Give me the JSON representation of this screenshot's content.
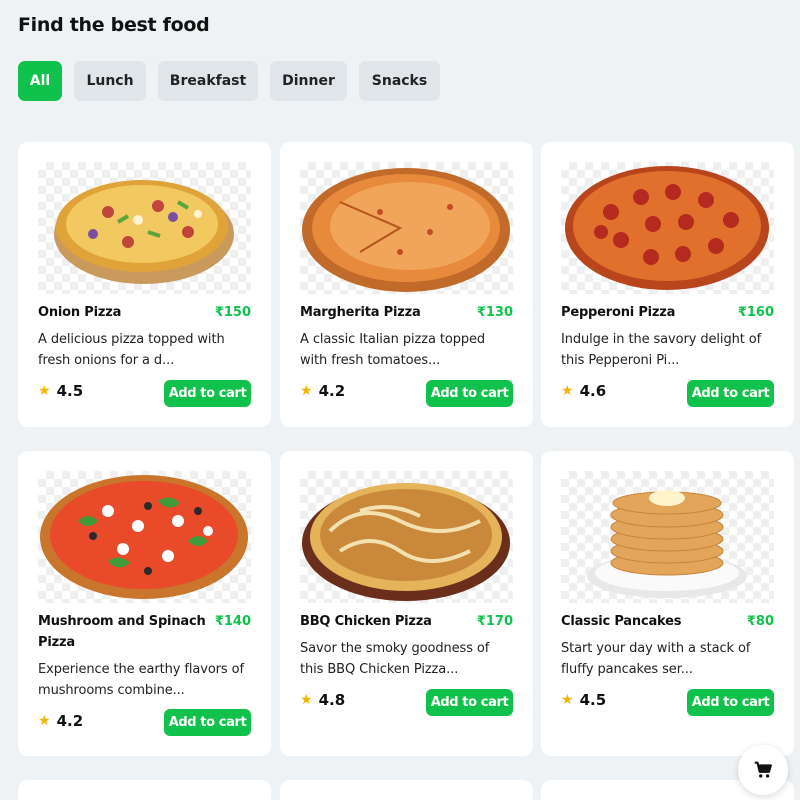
{
  "page": {
    "title": "Find the best food"
  },
  "filters": [
    {
      "label": "All",
      "active": true
    },
    {
      "label": "Lunch",
      "active": false
    },
    {
      "label": "Breakfast",
      "active": false
    },
    {
      "label": "Dinner",
      "active": false
    },
    {
      "label": "Snacks",
      "active": false
    }
  ],
  "products": [
    {
      "name": "Onion Pizza",
      "price": "₹150",
      "description": "A delicious pizza topped with fresh onions for a d...",
      "rating": "4.5",
      "cart_label": "Add to cart",
      "image": "onion-pizza"
    },
    {
      "name": "Margherita Pizza",
      "price": "₹130",
      "description": "A classic Italian pizza topped with fresh tomatoes...",
      "rating": "4.2",
      "cart_label": "Add to cart",
      "image": "margherita-pizza"
    },
    {
      "name": "Pepperoni Pizza",
      "price": "₹160",
      "description": "Indulge in the savory delight of this Pepperoni Pi...",
      "rating": "4.6",
      "cart_label": "Add to cart",
      "image": "pepperoni-pizza"
    },
    {
      "name": "Mushroom and Spinach Pizza",
      "price": "₹140",
      "description": "Experience the earthy flavors of mushrooms combine...",
      "rating": "4.2",
      "cart_label": "Add to cart",
      "image": "mushroom-spinach-pizza"
    },
    {
      "name": "BBQ Chicken Pizza",
      "price": "₹170",
      "description": "Savor the smoky goodness of this BBQ Chicken Pizza...",
      "rating": "4.8",
      "cart_label": "Add to cart",
      "image": "bbq-chicken-pizza"
    },
    {
      "name": "Classic Pancakes",
      "price": "₹80",
      "description": "Start your day with a stack of fluffy pancakes ser...",
      "rating": "4.5",
      "cart_label": "Add to cart",
      "image": "classic-pancakes"
    }
  ],
  "icons": {
    "rating": "star-icon",
    "cart": "shopping-cart-icon"
  },
  "colors": {
    "accent": "#10c24b",
    "background": "#eef2f4",
    "star": "#f5b400"
  }
}
